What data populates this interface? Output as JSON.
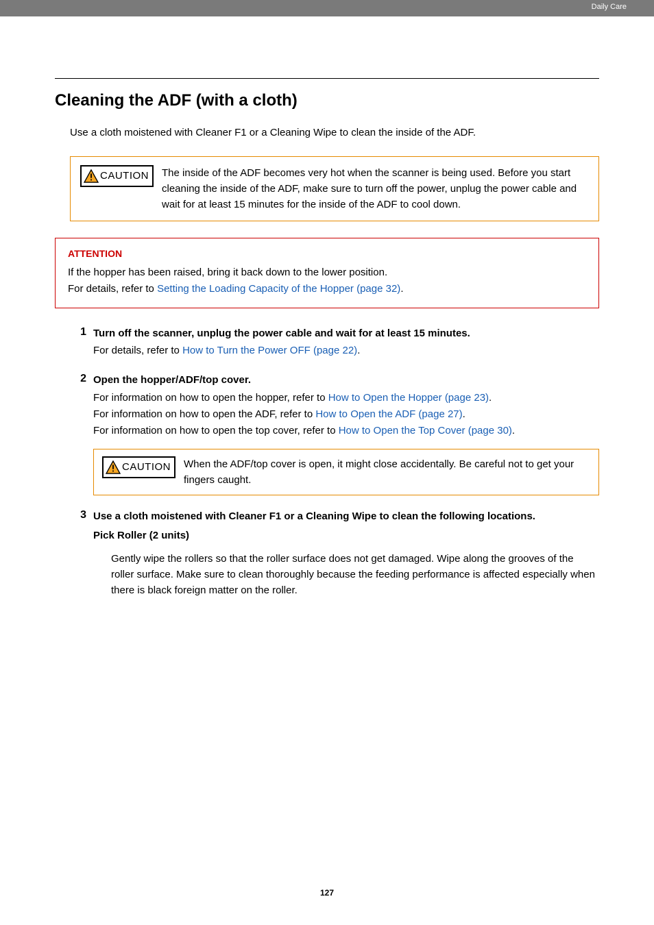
{
  "header": {
    "breadcrumb": "Daily Care"
  },
  "title": "Cleaning the ADF (with a cloth)",
  "intro": "Use a cloth moistened with Cleaner F1 or a Cleaning Wipe to clean the inside of the ADF.",
  "caution1": {
    "label": "CAUTION",
    "text": "The inside of the ADF becomes very hot when the scanner is being used. Before you start cleaning the inside of the ADF, make sure to turn off the power, unplug the power cable and wait for at least 15 minutes for the inside of the ADF to cool down."
  },
  "attention": {
    "title": "ATTENTION",
    "line1": "If the hopper has been raised, bring it back down to the lower position.",
    "line2_pre": "For details, refer to ",
    "line2_link": "Setting the Loading Capacity of the Hopper (page 32)",
    "line2_post": "."
  },
  "steps": [
    {
      "num": "1",
      "title": "Turn off the scanner, unplug the power cable and wait for at least 15 minutes.",
      "body_pre": "For details, refer to ",
      "body_link": "How to Turn the Power OFF (page 22)",
      "body_post": "."
    },
    {
      "num": "2",
      "title": "Open the hopper/ADF/top cover.",
      "l1_pre": "For information on how to open the hopper, refer to ",
      "l1_link": "How to Open the Hopper (page 23)",
      "l1_post": ".",
      "l2_pre": "For information on how to open the ADF, refer to ",
      "l2_link": "How to Open the ADF (page 27)",
      "l2_post": ".",
      "l3_pre": "For information on how to open the top cover, refer to ",
      "l3_link": "How to Open the Top Cover (page 30)",
      "l3_post": ".",
      "caution_label": "CAUTION",
      "caution_text": "When the ADF/top cover is open, it might close accidentally. Be careful not to get your fingers caught."
    },
    {
      "num": "3",
      "title": "Use a cloth moistened with Cleaner F1 or a Cleaning Wipe to clean the following locations.",
      "sub_heading": "Pick Roller (2 units)",
      "sub_body": "Gently wipe the rollers so that the roller surface does not get damaged. Wipe along the grooves of the roller surface. Make sure to clean thoroughly because the feeding performance is affected especially when there is black foreign matter on the roller."
    }
  ],
  "page_number": "127"
}
